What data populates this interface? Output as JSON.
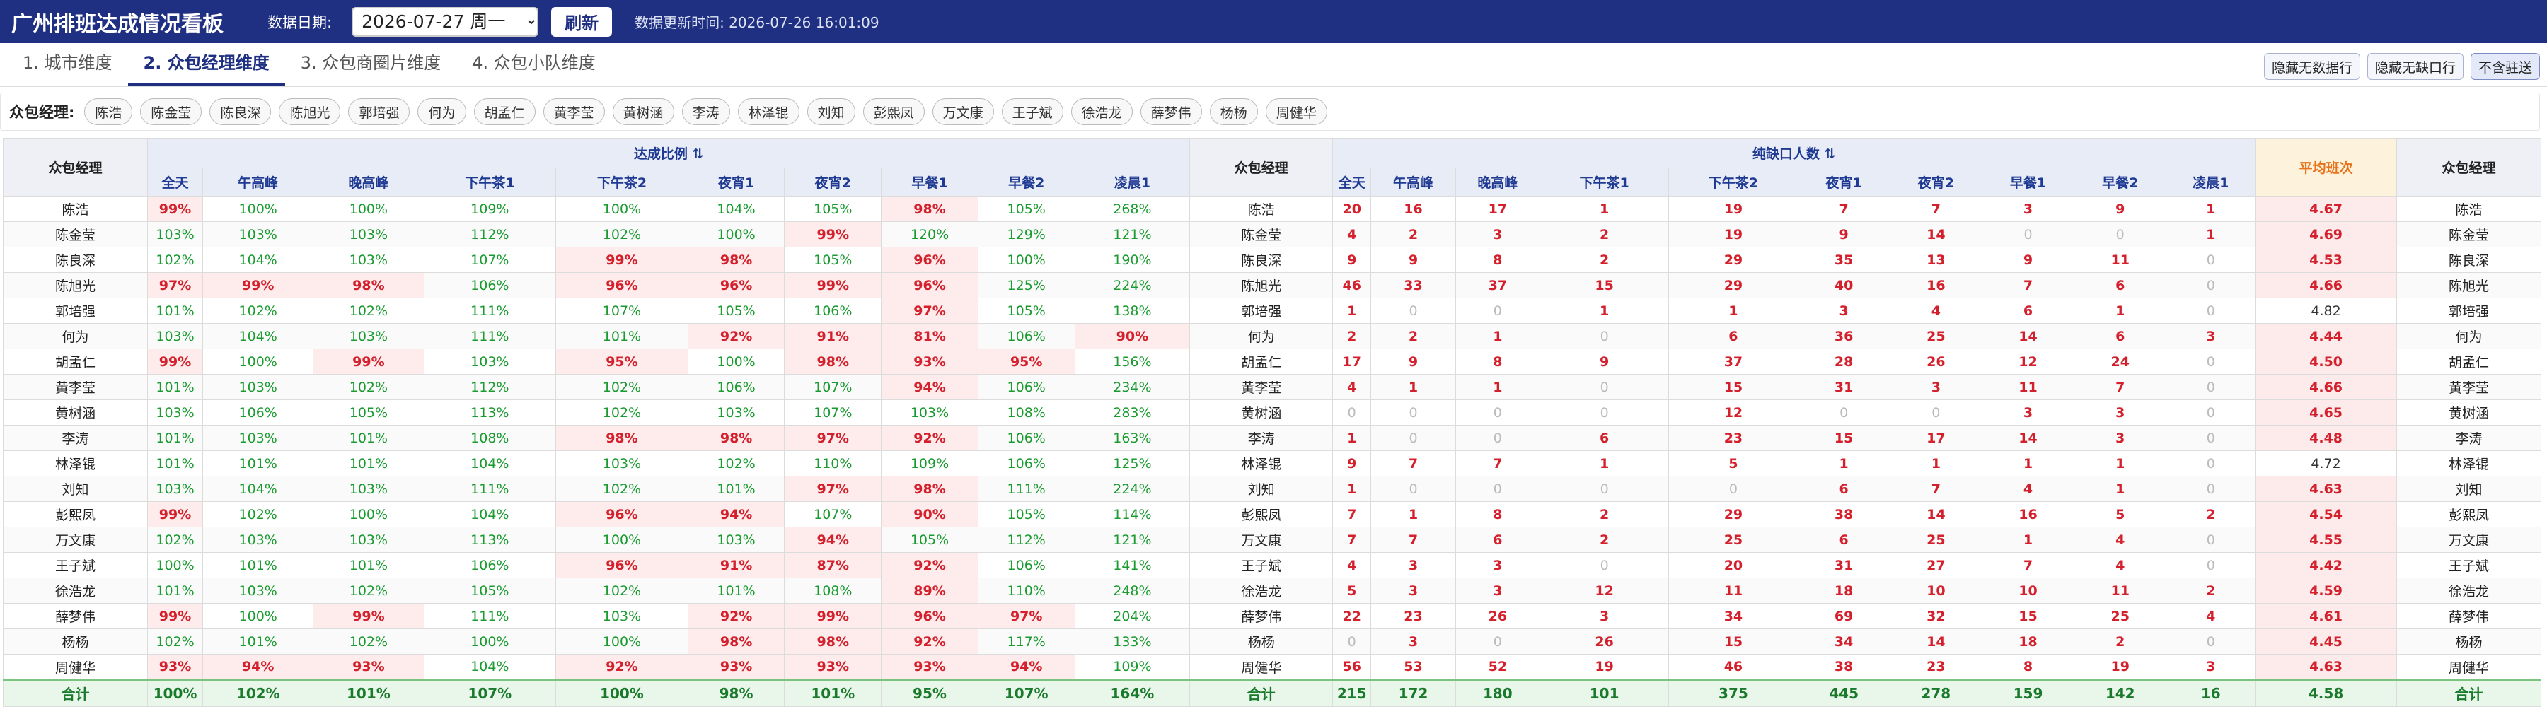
{
  "app": {
    "title": "广州排班达成情况看板",
    "date_label": "数据日期:",
    "date_value": "2026-07-27 周一",
    "refresh_label": "刷新",
    "update_label": "数据更新时间: 2026-07-26 16:01:09"
  },
  "tabs": [
    "1. 城市维度",
    "2. 众包经理维度",
    "3. 众包商圈片维度",
    "4. 众包小队维度"
  ],
  "active_tab": 1,
  "toggles": [
    "隐藏无数据行",
    "隐藏无缺口行",
    "不含驻送"
  ],
  "filter": {
    "label": "众包经理:",
    "chips": [
      "陈浩",
      "陈金莹",
      "陈良深",
      "陈旭光",
      "郭培强",
      "何为",
      "胡孟仁",
      "黄李莹",
      "黄树涵",
      "李涛",
      "林泽锟",
      "刘知",
      "彭熙凤",
      "万文康",
      "王子斌",
      "徐浩龙",
      "薛梦伟",
      "杨杨",
      "周健华"
    ]
  },
  "table": {
    "name_header": "众包经理",
    "group1": "达成比例 ⇅",
    "group2": "纯缺口人数 ⇅",
    "avg_header": "平均班次",
    "columns": [
      "全天",
      "午高峰",
      "晚高峰",
      "下午茶1",
      "下午茶2",
      "夜宵1",
      "夜宵2",
      "早餐1",
      "早餐2",
      "凌晨1"
    ],
    "rows": [
      {
        "name": "陈浩",
        "rate": [
          "99%",
          "100%",
          "100%",
          "109%",
          "100%",
          "104%",
          "105%",
          "98%",
          "105%",
          "268%"
        ],
        "gap": [
          "20",
          "16",
          "17",
          "1",
          "19",
          "7",
          "7",
          "3",
          "9",
          "1"
        ],
        "avg": "4.67"
      },
      {
        "name": "陈金莹",
        "rate": [
          "103%",
          "103%",
          "103%",
          "112%",
          "102%",
          "100%",
          "99%",
          "120%",
          "129%",
          "121%"
        ],
        "gap": [
          "4",
          "2",
          "3",
          "2",
          "19",
          "9",
          "14",
          "0",
          "0",
          "1"
        ],
        "avg": "4.69"
      },
      {
        "name": "陈良深",
        "rate": [
          "102%",
          "104%",
          "103%",
          "107%",
          "99%",
          "98%",
          "105%",
          "96%",
          "100%",
          "190%"
        ],
        "gap": [
          "9",
          "9",
          "8",
          "2",
          "29",
          "35",
          "13",
          "9",
          "11",
          "0"
        ],
        "avg": "4.53"
      },
      {
        "name": "陈旭光",
        "rate": [
          "97%",
          "99%",
          "98%",
          "106%",
          "96%",
          "96%",
          "99%",
          "96%",
          "125%",
          "224%"
        ],
        "gap": [
          "46",
          "33",
          "37",
          "15",
          "29",
          "40",
          "16",
          "7",
          "6",
          "0"
        ],
        "avg": "4.66"
      },
      {
        "name": "郭培强",
        "rate": [
          "101%",
          "102%",
          "102%",
          "111%",
          "107%",
          "105%",
          "106%",
          "97%",
          "105%",
          "138%"
        ],
        "gap": [
          "1",
          "0",
          "0",
          "1",
          "1",
          "3",
          "4",
          "6",
          "1",
          "0"
        ],
        "avg": "4.82"
      },
      {
        "name": "何为",
        "rate": [
          "103%",
          "104%",
          "103%",
          "111%",
          "101%",
          "92%",
          "91%",
          "81%",
          "106%",
          "90%"
        ],
        "gap": [
          "2",
          "2",
          "1",
          "0",
          "6",
          "36",
          "25",
          "14",
          "6",
          "3"
        ],
        "avg": "4.44"
      },
      {
        "name": "胡孟仁",
        "rate": [
          "99%",
          "100%",
          "99%",
          "103%",
          "95%",
          "100%",
          "98%",
          "93%",
          "95%",
          "156%"
        ],
        "gap": [
          "17",
          "9",
          "8",
          "9",
          "37",
          "28",
          "26",
          "12",
          "24",
          "0"
        ],
        "avg": "4.50"
      },
      {
        "name": "黄李莹",
        "rate": [
          "101%",
          "103%",
          "102%",
          "112%",
          "102%",
          "106%",
          "107%",
          "94%",
          "106%",
          "234%"
        ],
        "gap": [
          "4",
          "1",
          "1",
          "0",
          "15",
          "31",
          "3",
          "11",
          "7",
          "0"
        ],
        "avg": "4.66"
      },
      {
        "name": "黄树涵",
        "rate": [
          "103%",
          "106%",
          "105%",
          "113%",
          "102%",
          "103%",
          "107%",
          "103%",
          "108%",
          "283%"
        ],
        "gap": [
          "0",
          "0",
          "0",
          "0",
          "12",
          "0",
          "0",
          "3",
          "3",
          "0"
        ],
        "avg": "4.65"
      },
      {
        "name": "李涛",
        "rate": [
          "101%",
          "103%",
          "101%",
          "108%",
          "98%",
          "98%",
          "97%",
          "92%",
          "106%",
          "163%"
        ],
        "gap": [
          "1",
          "0",
          "0",
          "6",
          "23",
          "15",
          "17",
          "14",
          "3",
          "0"
        ],
        "avg": "4.48"
      },
      {
        "name": "林泽锟",
        "rate": [
          "101%",
          "101%",
          "101%",
          "104%",
          "103%",
          "102%",
          "110%",
          "109%",
          "106%",
          "125%"
        ],
        "gap": [
          "9",
          "7",
          "7",
          "1",
          "5",
          "1",
          "1",
          "1",
          "1",
          "0"
        ],
        "avg": "4.72"
      },
      {
        "name": "刘知",
        "rate": [
          "103%",
          "104%",
          "103%",
          "111%",
          "102%",
          "101%",
          "97%",
          "98%",
          "111%",
          "224%"
        ],
        "gap": [
          "1",
          "0",
          "0",
          "0",
          "0",
          "6",
          "7",
          "4",
          "1",
          "0"
        ],
        "avg": "4.63"
      },
      {
        "name": "彭熙凤",
        "rate": [
          "99%",
          "102%",
          "100%",
          "104%",
          "96%",
          "94%",
          "107%",
          "90%",
          "105%",
          "114%"
        ],
        "gap": [
          "7",
          "1",
          "8",
          "2",
          "29",
          "38",
          "14",
          "16",
          "5",
          "2"
        ],
        "avg": "4.54"
      },
      {
        "name": "万文康",
        "rate": [
          "102%",
          "103%",
          "103%",
          "113%",
          "100%",
          "103%",
          "94%",
          "105%",
          "112%",
          "121%"
        ],
        "gap": [
          "7",
          "7",
          "6",
          "2",
          "25",
          "6",
          "25",
          "1",
          "4",
          "0"
        ],
        "avg": "4.55"
      },
      {
        "name": "王子斌",
        "rate": [
          "100%",
          "101%",
          "101%",
          "106%",
          "96%",
          "91%",
          "87%",
          "92%",
          "106%",
          "141%"
        ],
        "gap": [
          "4",
          "3",
          "3",
          "0",
          "20",
          "31",
          "27",
          "7",
          "4",
          "0"
        ],
        "avg": "4.42"
      },
      {
        "name": "徐浩龙",
        "rate": [
          "101%",
          "103%",
          "102%",
          "105%",
          "102%",
          "101%",
          "108%",
          "89%",
          "110%",
          "248%"
        ],
        "gap": [
          "5",
          "3",
          "3",
          "12",
          "11",
          "18",
          "10",
          "10",
          "11",
          "2"
        ],
        "avg": "4.59"
      },
      {
        "name": "薛梦伟",
        "rate": [
          "99%",
          "100%",
          "99%",
          "111%",
          "103%",
          "92%",
          "99%",
          "96%",
          "97%",
          "204%"
        ],
        "gap": [
          "22",
          "23",
          "26",
          "3",
          "34",
          "69",
          "32",
          "15",
          "25",
          "4"
        ],
        "avg": "4.61"
      },
      {
        "name": "杨杨",
        "rate": [
          "102%",
          "101%",
          "102%",
          "100%",
          "100%",
          "98%",
          "98%",
          "92%",
          "117%",
          "133%"
        ],
        "gap": [
          "0",
          "3",
          "0",
          "26",
          "15",
          "34",
          "14",
          "18",
          "2",
          "0"
        ],
        "avg": "4.45"
      },
      {
        "name": "周健华",
        "rate": [
          "93%",
          "94%",
          "93%",
          "104%",
          "92%",
          "93%",
          "93%",
          "93%",
          "94%",
          "109%"
        ],
        "gap": [
          "56",
          "53",
          "52",
          "19",
          "46",
          "38",
          "23",
          "8",
          "19",
          "3"
        ],
        "avg": "4.63"
      }
    ],
    "total": {
      "name": "合计",
      "rate": [
        "100%",
        "102%",
        "101%",
        "107%",
        "100%",
        "98%",
        "101%",
        "95%",
        "107%",
        "164%"
      ],
      "gap": [
        "215",
        "172",
        "180",
        "101",
        "375",
        "445",
        "278",
        "159",
        "142",
        "16"
      ],
      "avg": "4.58"
    }
  },
  "colors": {
    "header_bg": "#1f2f82",
    "good": "#1a9b30",
    "bad": "#d4202c",
    "bad_bg": "#fdeceb",
    "avg_header": "#e8731a"
  }
}
